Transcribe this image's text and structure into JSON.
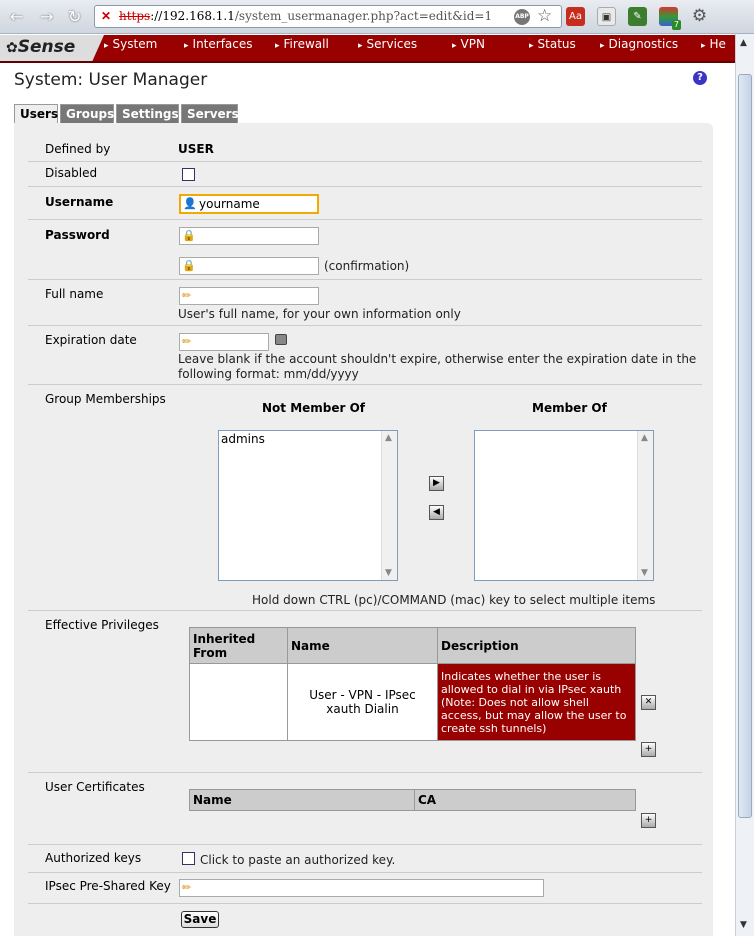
{
  "browser": {
    "url_scheme": "https",
    "url_rest_host": "://192.168.1.1",
    "url_path": "/system_usermanager.php?act=edit&id=1",
    "abp_label": "ABP",
    "ext_pdf_label": "Aa",
    "ext_badge": "7"
  },
  "nav": {
    "logo": "Sense",
    "items": [
      "System",
      "Interfaces",
      "Firewall",
      "Services",
      "VPN",
      "Status",
      "Diagnostics",
      "He"
    ]
  },
  "page": {
    "title": "System: User Manager",
    "help_icon": "?"
  },
  "tabs": [
    {
      "label": "Users",
      "active": true
    },
    {
      "label": "Groups",
      "active": false
    },
    {
      "label": "Settings",
      "active": false
    },
    {
      "label": "Servers",
      "active": false
    }
  ],
  "form": {
    "defined_by_label": "Defined by",
    "defined_by_value": "USER",
    "disabled_label": "Disabled",
    "username_label": "Username",
    "username_value": "yourname",
    "password_label": "Password",
    "password_confirm_hint": "(confirmation)",
    "fullname_label": "Full name",
    "fullname_hint": "User's full name, for your own information only",
    "expiration_label": "Expiration date",
    "expiration_hint_1": "Leave blank if the account shouldn't expire, otherwise enter the expiration date in the",
    "expiration_hint_2": "following format: mm/dd/yyyy",
    "groups_label": "Group Memberships",
    "not_member_header": "Not Member Of",
    "member_header": "Member Of",
    "not_member_items": [
      "admins"
    ],
    "member_items": [],
    "groups_hint": "Hold down CTRL (pc)/COMMAND (mac) key to select multiple items",
    "privileges_label": "Effective Privileges",
    "priv_headers": {
      "inherited": "Inherited From",
      "name": "Name",
      "description": "Description"
    },
    "privileges": [
      {
        "inherited": "",
        "name": "User - VPN - IPsec xauth Dialin",
        "description": "Indicates whether the user is allowed to dial in via IPsec xauth (Note: Does not allow shell access, but may allow the user to create ssh tunnels)"
      }
    ],
    "certs_label": "User Certificates",
    "cert_headers": {
      "name": "Name",
      "ca": "CA"
    },
    "authkeys_label": "Authorized keys",
    "authkeys_hint": "Click to paste an authorized key.",
    "psk_label": "IPsec Pre-Shared Key",
    "save_label": "Save"
  },
  "colors": {
    "nav_bg": "#990000",
    "desc_bg": "#990000",
    "panel_bg": "#eeeeee",
    "help": "#3c34c4"
  }
}
